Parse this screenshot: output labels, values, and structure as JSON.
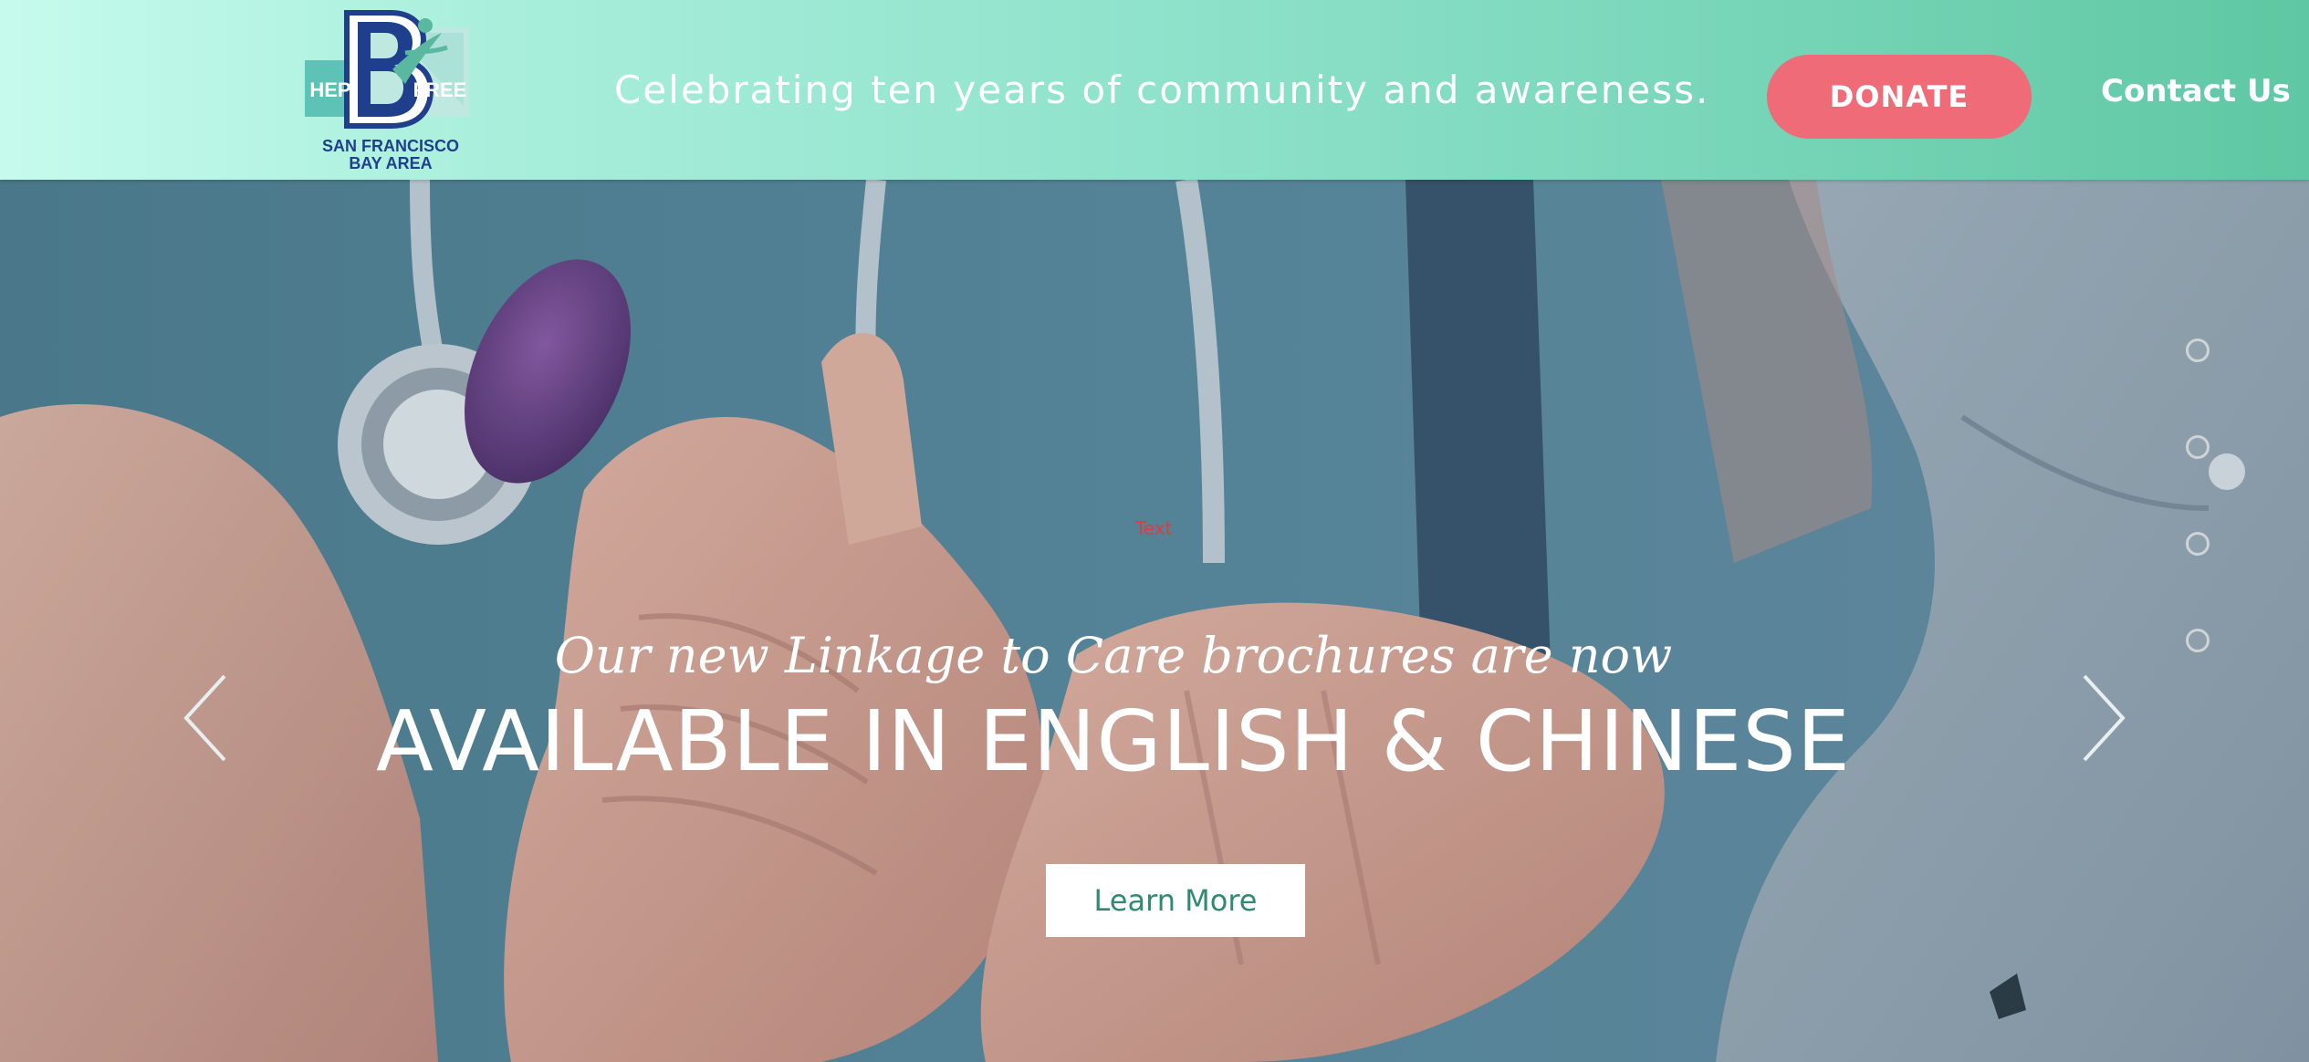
{
  "header": {
    "logo": {
      "hep": "HEP",
      "letter": "B",
      "free": "FREE",
      "line1": "SAN FRANCISCO",
      "line2": "BAY AREA",
      "colors": {
        "navy": "#1f3f8c",
        "teal": "#5fc2b6",
        "green": "#5ab7a0"
      }
    },
    "tagline": "Celebrating ten years of community and awareness.",
    "donate_label": "DONATE",
    "contact_label": "Contact Us",
    "colors": {
      "gradient_start": "#c6fbec",
      "gradient_end": "#5fc7a3",
      "donate": "#ee6b77"
    }
  },
  "hero": {
    "image": "photo-nurse-holding-patient-hands-with-stethoscope",
    "placeholder_text": "Text",
    "subtitle": "Our new Linkage to Care brochures are now",
    "title": "AVAILABLE IN ENGLISH & CHINESE",
    "button_label": "Learn More",
    "prev_icon": "chevron-left-icon",
    "next_icon": "chevron-right-icon",
    "slide_dots": 4,
    "colors": {
      "button_text": "#2e8a73"
    }
  }
}
